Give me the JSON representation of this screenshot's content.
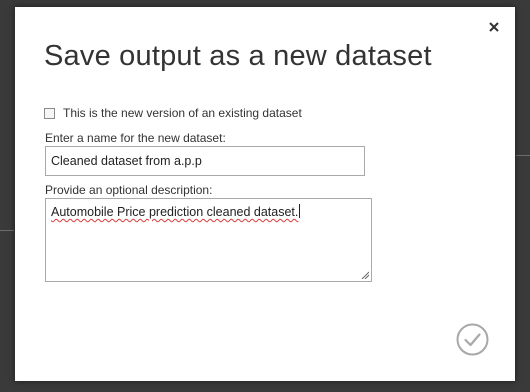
{
  "dialog": {
    "title": "Save output as a new dataset",
    "checkbox_label": "This is the new version of an existing dataset",
    "checkbox_checked": false,
    "name_label": "Enter a name for the new dataset:",
    "name_value": "Cleaned dataset from a.p.p",
    "description_label": "Provide an optional description:",
    "description_value": "Automobile Price prediction cleaned dataset.",
    "close_icon": "close-icon",
    "ok_icon": "checkmark-circle-icon"
  },
  "colors": {
    "backdrop": "#3a3a3a",
    "dialog_bg": "#ffffff",
    "text": "#333333",
    "border": "#a9a9a9",
    "ok_icon": "#a8a8a8",
    "spellcheck_underline": "#d93a3a"
  }
}
